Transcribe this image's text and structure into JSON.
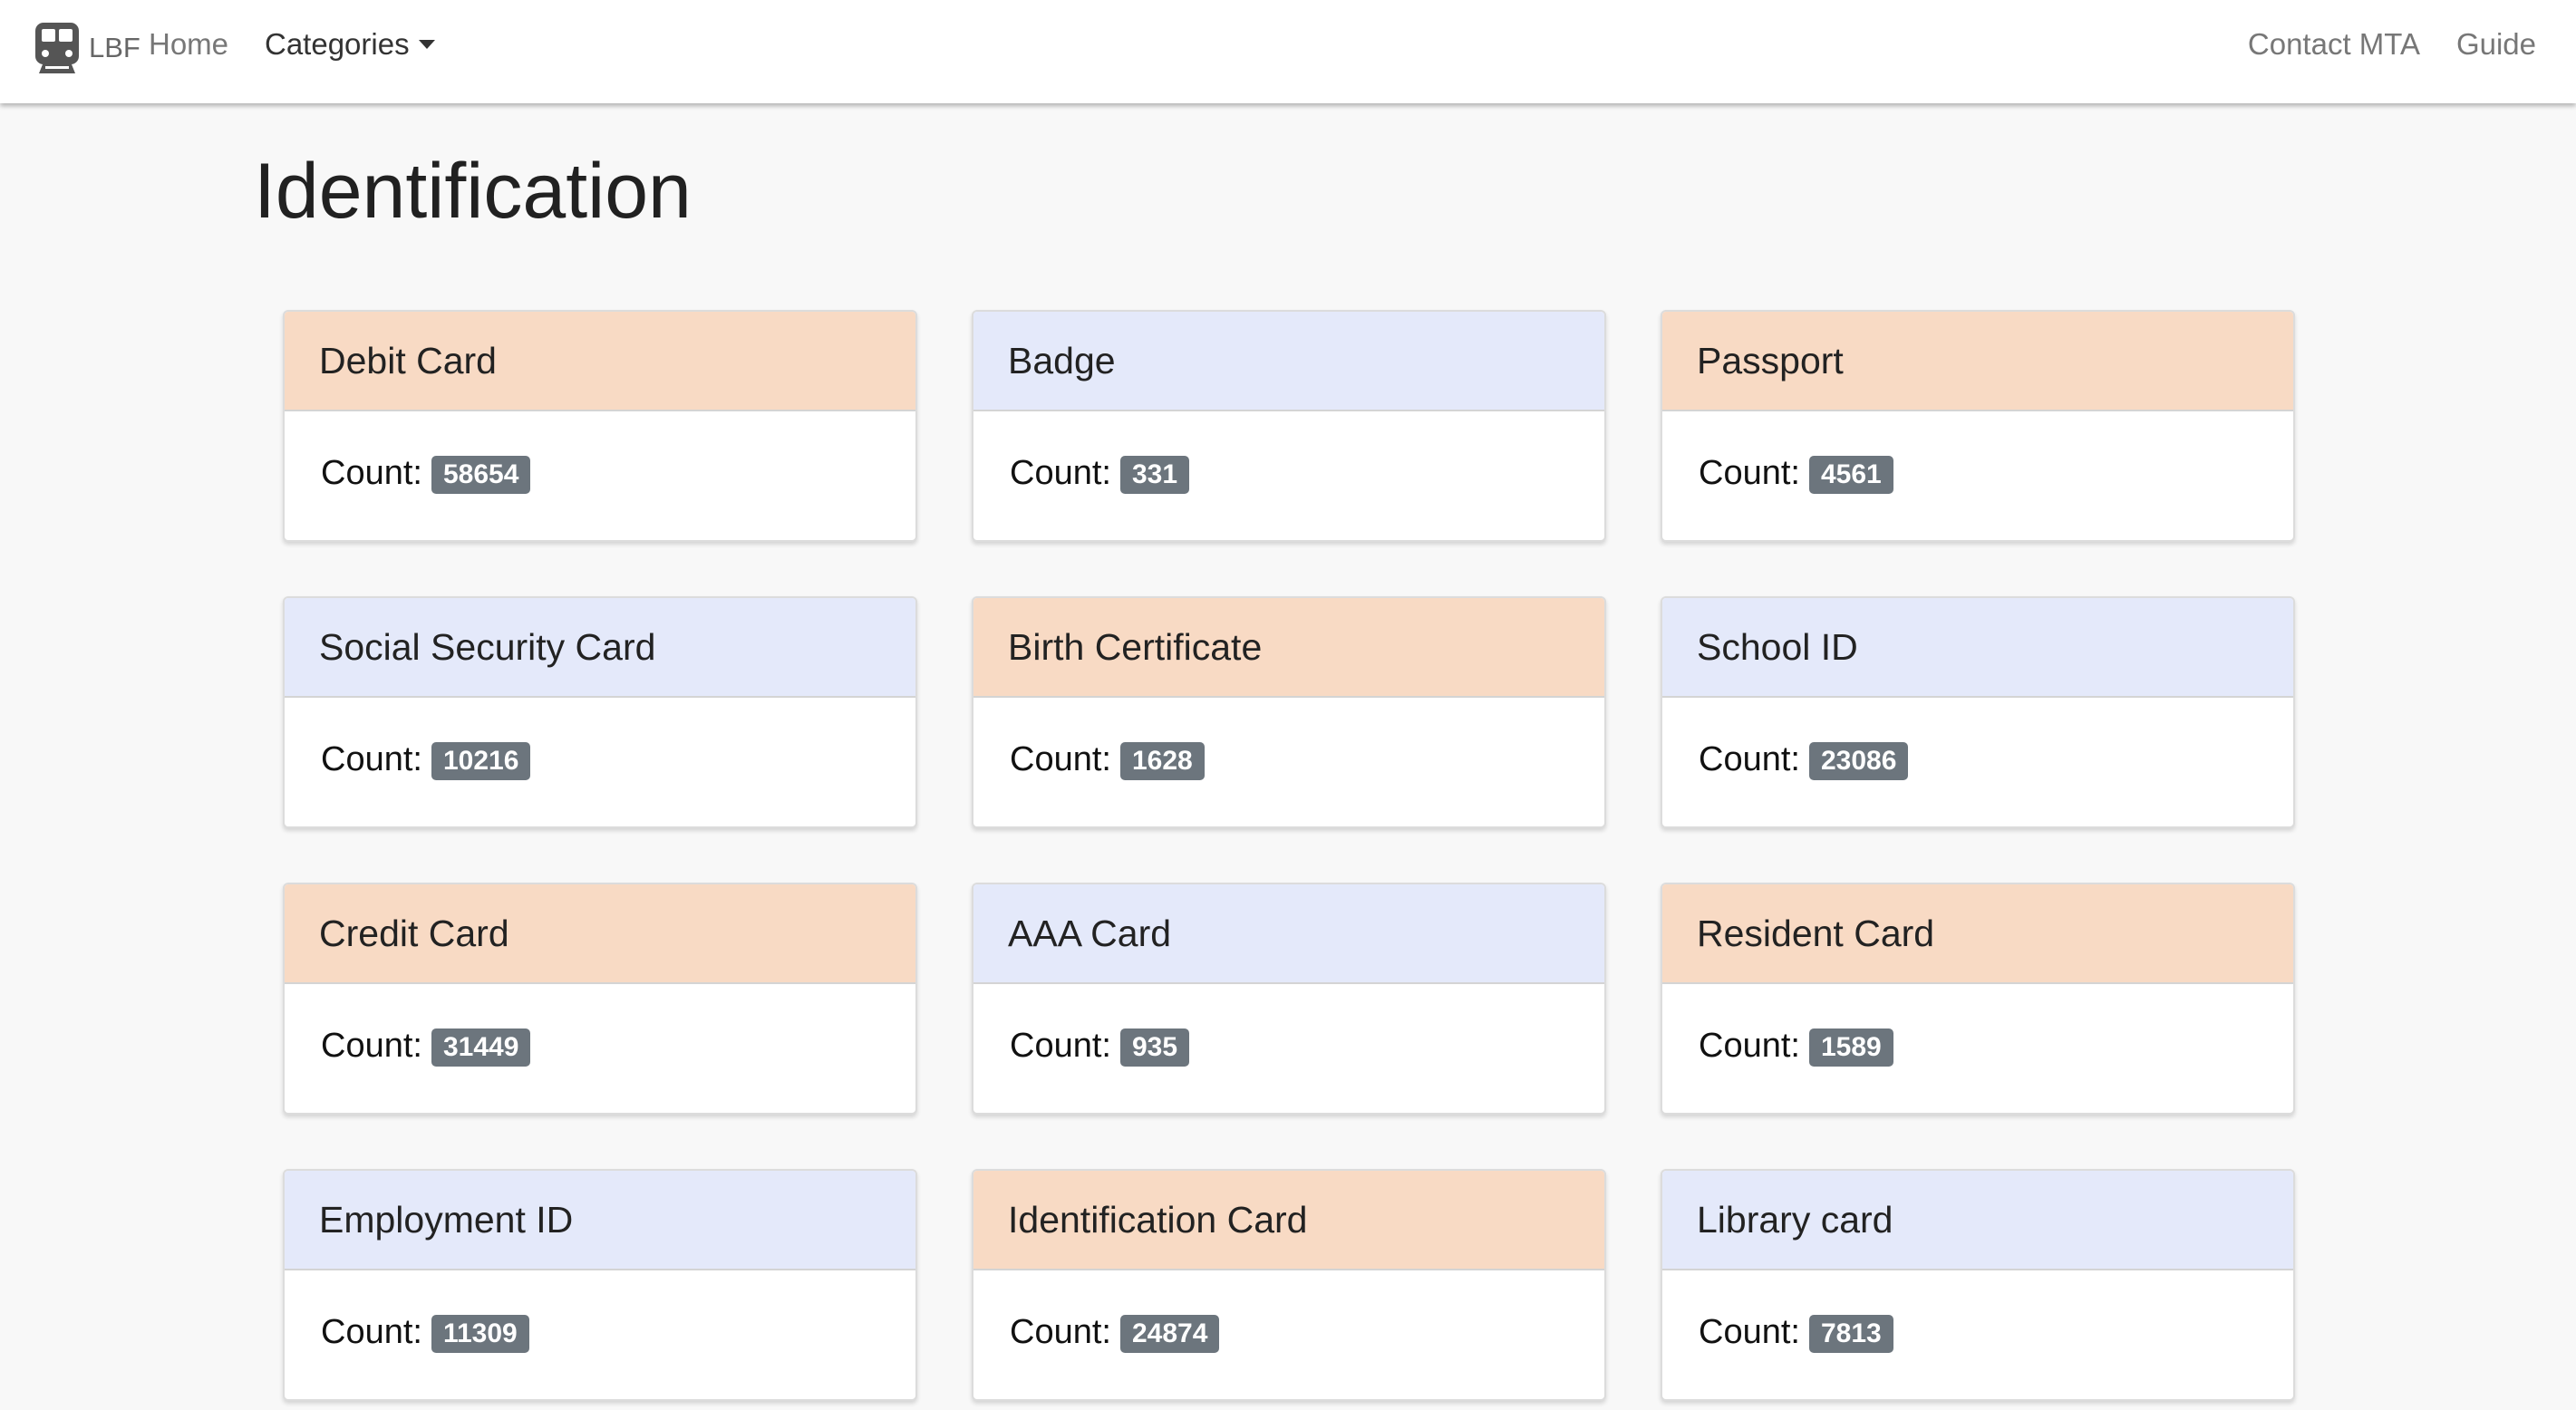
{
  "navbar": {
    "brand_text": "LBF",
    "brand_icon": "train-icon",
    "links": {
      "home": "Home",
      "categories": "Categories",
      "contact": "Contact MTA",
      "guide": "Guide"
    }
  },
  "page": {
    "title": "Identification"
  },
  "colors": {
    "header_peach": "#f8dac4",
    "header_blue": "#e4e9fa",
    "badge": "#6c757d"
  },
  "count_label": "Count:",
  "cards": [
    {
      "title": "Debit Card",
      "count": "58654",
      "tint": "peach"
    },
    {
      "title": "Badge",
      "count": "331",
      "tint": "blue"
    },
    {
      "title": "Passport",
      "count": "4561",
      "tint": "peach"
    },
    {
      "title": "Social Security Card",
      "count": "10216",
      "tint": "blue"
    },
    {
      "title": "Birth Certificate",
      "count": "1628",
      "tint": "peach"
    },
    {
      "title": "School ID",
      "count": "23086",
      "tint": "blue"
    },
    {
      "title": "Credit Card",
      "count": "31449",
      "tint": "peach"
    },
    {
      "title": "AAA Card",
      "count": "935",
      "tint": "blue"
    },
    {
      "title": "Resident Card",
      "count": "1589",
      "tint": "peach"
    },
    {
      "title": "Employment ID",
      "count": "11309",
      "tint": "blue"
    },
    {
      "title": "Identification Card",
      "count": "24874",
      "tint": "peach"
    },
    {
      "title": "Library card",
      "count": "7813",
      "tint": "blue"
    }
  ]
}
